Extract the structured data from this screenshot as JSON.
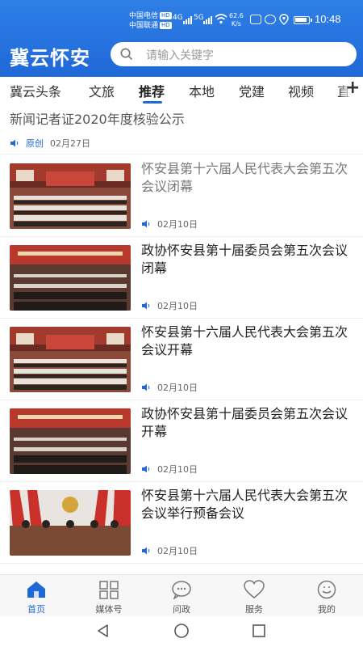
{
  "status_bar": {
    "carrier_1": "中国电信",
    "carrier_2": "中国联通",
    "hd_badge": "HD",
    "network_1": "4G",
    "network_2": "5G",
    "net_speed": "62.6",
    "net_speed_unit": "K/s",
    "time": "10:48"
  },
  "header": {
    "app_title": "冀云怀安",
    "search_placeholder": "请输入关键字"
  },
  "tabs": [
    {
      "label": "冀云头条",
      "active": false
    },
    {
      "label": "文旅",
      "active": false
    },
    {
      "label": "推荐",
      "active": true
    },
    {
      "label": "本地",
      "active": false
    },
    {
      "label": "党建",
      "active": false
    },
    {
      "label": "视频",
      "active": false
    },
    {
      "label": "直",
      "active": false
    }
  ],
  "top_item": {
    "title": "新闻记者证2020年度核验公示",
    "source": "原创",
    "date": "02月27日"
  },
  "news": [
    {
      "title": "怀安县第十六届人民代表大会第五次会议闭幕",
      "date": "02月10日",
      "read": true
    },
    {
      "title": "政协怀安县第十届委员会第五次会议闭幕",
      "date": "02月10日",
      "read": false
    },
    {
      "title": "怀安县第十六届人民代表大会第五次会议开幕",
      "date": "02月10日",
      "read": false
    },
    {
      "title": "政协怀安县第十届委员会第五次会议开幕",
      "date": "02月10日",
      "read": false
    },
    {
      "title": "怀安县第十六届人民代表大会第五次会议举行预备会议",
      "date": "02月10日",
      "read": false
    }
  ],
  "bottom_nav": [
    {
      "label": "首页",
      "active": true
    },
    {
      "label": "媒体号",
      "active": false
    },
    {
      "label": "问政",
      "active": false
    },
    {
      "label": "服务",
      "active": false
    },
    {
      "label": "我的",
      "active": false
    }
  ],
  "colors": {
    "brand": "#1f68d8",
    "header_bg": "#2f7fe6"
  }
}
